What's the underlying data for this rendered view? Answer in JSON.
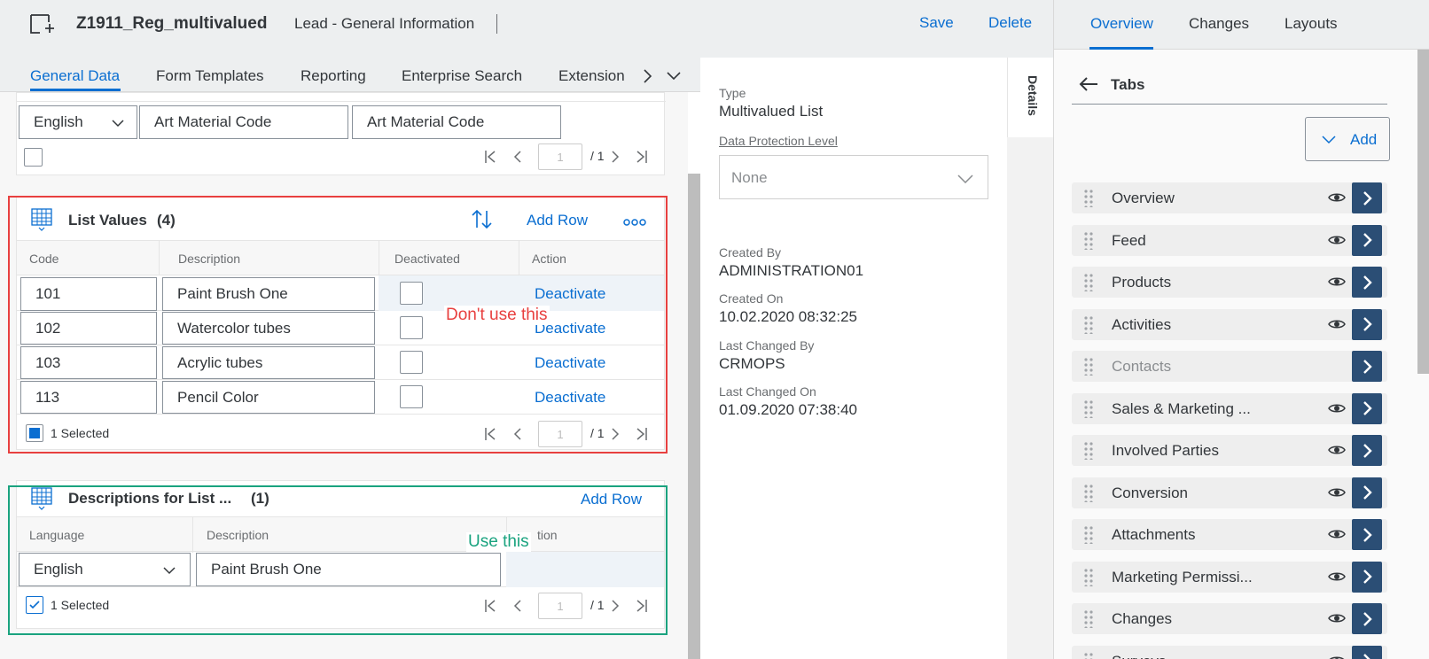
{
  "header": {
    "title": "Z1911_Reg_multivalued",
    "subtitle": "Lead - General Information",
    "save_label": "Save",
    "delete_label": "Delete"
  },
  "tabs": [
    "General Data",
    "Form Templates",
    "Reporting",
    "Enterprise Search",
    "Extension"
  ],
  "top_table": {
    "language": "English",
    "label1": "Art Material Code",
    "label2": "Art Material Code",
    "page": "1",
    "page_total": "/ 1"
  },
  "list_values": {
    "title": "List Values",
    "count": "(4)",
    "add_row_label": "Add Row",
    "columns": [
      "Code",
      "Description",
      "Deactivated",
      "Action"
    ],
    "rows": [
      {
        "code": "101",
        "description": "Paint Brush One",
        "action": "Deactivate"
      },
      {
        "code": "102",
        "description": "Watercolor tubes",
        "action": "Deactivate"
      },
      {
        "code": "103",
        "description": "Acrylic tubes",
        "action": "Deactivate"
      },
      {
        "code": "113",
        "description": "Pencil Color",
        "action": "Deactivate"
      }
    ],
    "selected_text": "1 Selected",
    "page": "1",
    "page_total": "/ 1",
    "annotation": "Don't use this"
  },
  "descriptions": {
    "title": "Descriptions for List ...",
    "count": "(1)",
    "add_row_label": "Add Row",
    "columns": [
      "Language",
      "Description",
      "tion"
    ],
    "language": "English",
    "description": "Paint Brush One",
    "selected_text": "1 Selected",
    "page": "1",
    "page_total": "/ 1",
    "annotation": "Use this"
  },
  "details": {
    "tab_label": "Details",
    "type_label": "Type",
    "type_value": "Multivalued List",
    "dpl_label": "Data Protection Level",
    "dpl_value": "None",
    "created_by_label": "Created By",
    "created_by": "ADMINISTRATION01",
    "created_on_label": "Created On",
    "created_on": "10.02.2020 08:32:25",
    "changed_by_label": "Last Changed By",
    "changed_by": "CRMOPS",
    "changed_on_label": "Last Changed On",
    "changed_on": "01.09.2020 07:38:40"
  },
  "side_panel": {
    "tabs": [
      "Overview",
      "Changes",
      "Layouts"
    ],
    "section_title": "Tabs",
    "add_label": "Add",
    "items": [
      {
        "label": "Overview",
        "visible": true
      },
      {
        "label": "Feed",
        "visible": true
      },
      {
        "label": "Products",
        "visible": true
      },
      {
        "label": "Activities",
        "visible": true
      },
      {
        "label": "Contacts",
        "visible": false
      },
      {
        "label": "Sales & Marketing ...",
        "visible": true
      },
      {
        "label": "Involved Parties",
        "visible": true
      },
      {
        "label": "Conversion",
        "visible": true
      },
      {
        "label": "Attachments",
        "visible": true
      },
      {
        "label": "Marketing Permissi...",
        "visible": true
      },
      {
        "label": "Changes",
        "visible": true
      },
      {
        "label": "Surveys",
        "visible": true
      }
    ]
  },
  "colors": {
    "accent": "#0a6ed1",
    "annotation_red": "#e8403f",
    "annotation_green": "#1aa37f",
    "nav_button": "#2b4e75"
  }
}
